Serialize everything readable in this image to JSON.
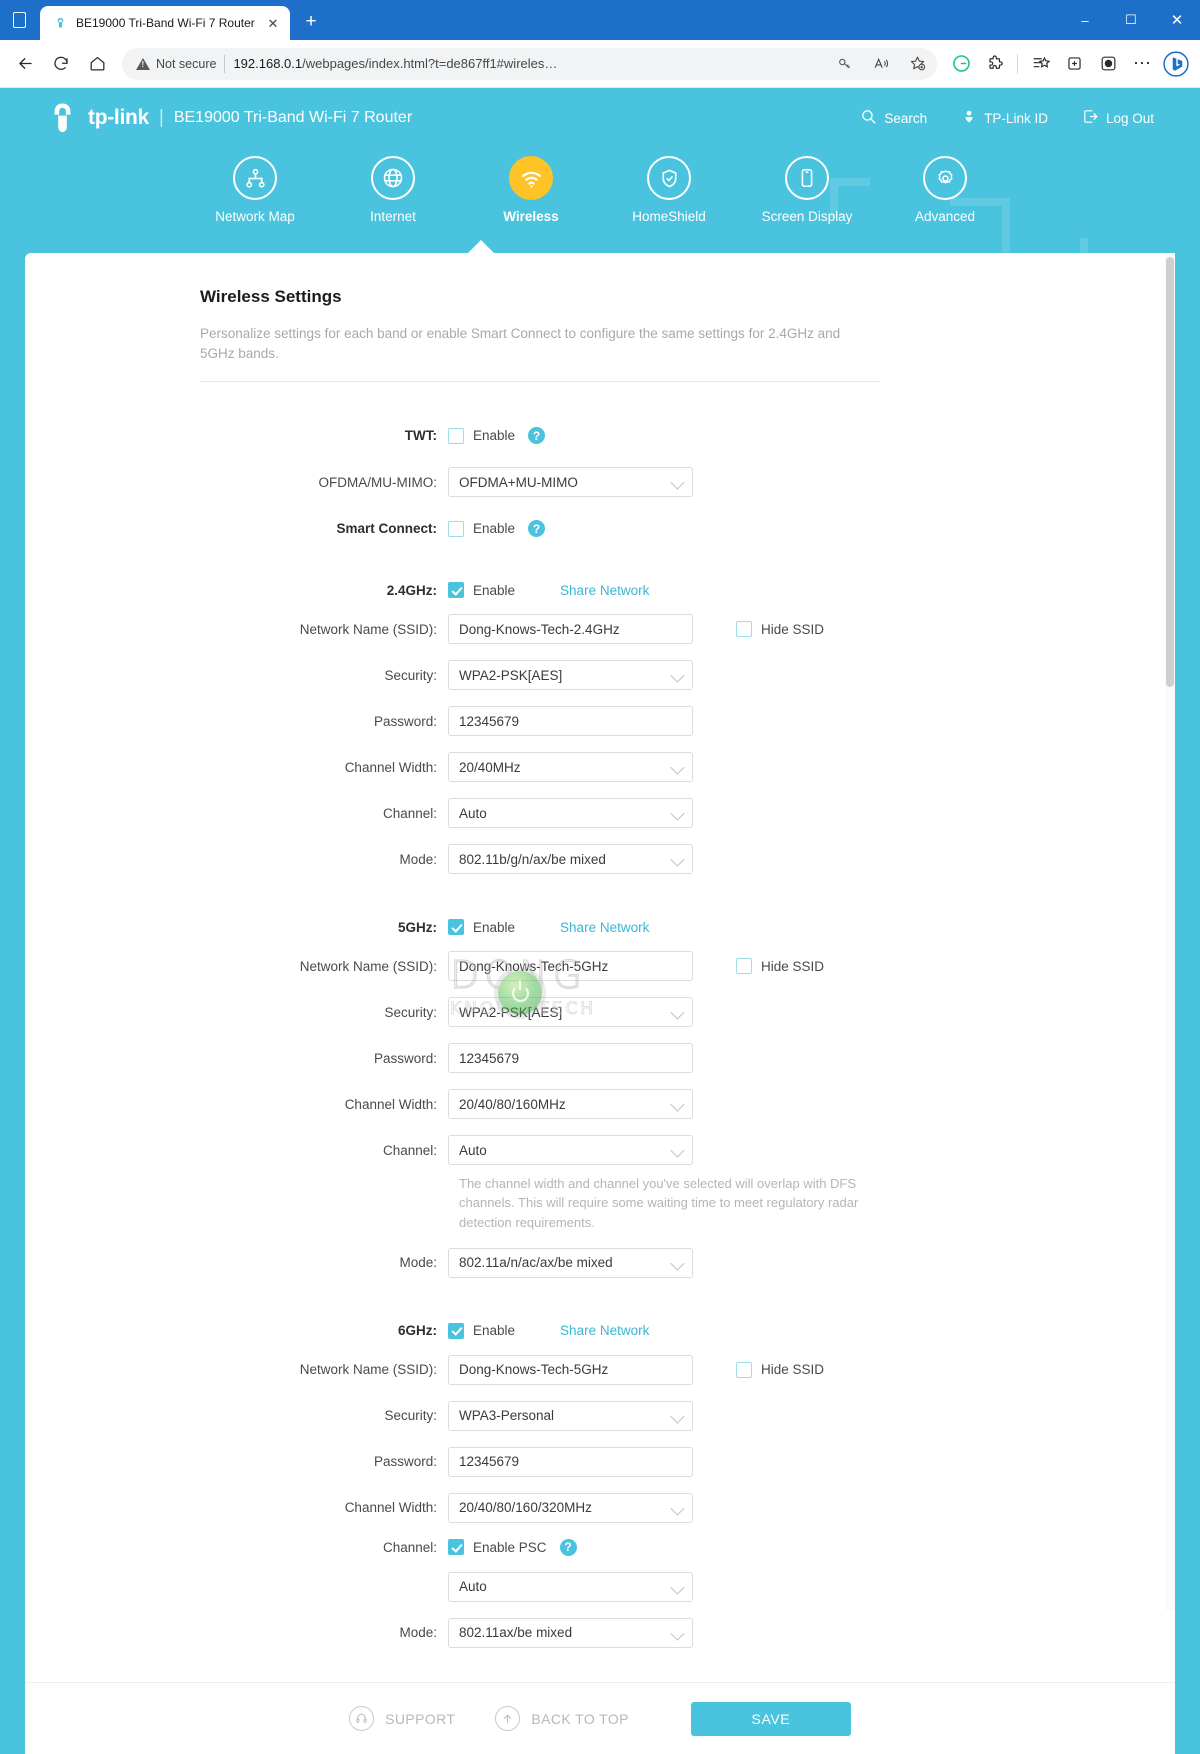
{
  "browser": {
    "tab_title": "BE19000 Tri-Band Wi-Fi 7 Router",
    "tab_favicon_name": "tp-link-favicon",
    "new_tab_label": "+",
    "close_tab_label": "✕",
    "minimize_label": "–",
    "maximize_label": "☐",
    "close_label": "✕",
    "security_label": "Not secure",
    "url_host": "192.168.0.1",
    "url_path": "/webpages/index.html?t=de867ff1#wireles…",
    "back_label": "←",
    "reload_label": "↻",
    "home_label": "⌂",
    "more_label": "⋯"
  },
  "app": {
    "brand": "tp-link",
    "brand_separator": "|",
    "model": "BE19000 Tri-Band Wi-Fi 7 Router",
    "header_actions": [
      {
        "label": "Search",
        "icon": "search-icon"
      },
      {
        "label": "TP-Link ID",
        "icon": "user-icon"
      },
      {
        "label": "Log Out",
        "icon": "logout-icon"
      }
    ],
    "nav": [
      {
        "label": "Network Map",
        "icon": "network-map-icon",
        "active": false
      },
      {
        "label": "Internet",
        "icon": "globe-icon",
        "active": false
      },
      {
        "label": "Wireless",
        "icon": "wifi-icon",
        "active": true
      },
      {
        "label": "HomeShield",
        "icon": "homeshield-icon",
        "active": false
      },
      {
        "label": "Screen Display",
        "icon": "screen-display-icon",
        "active": false
      },
      {
        "label": "Advanced",
        "icon": "gear-icon",
        "active": false
      }
    ],
    "accent_color": "#4ac3de",
    "active_nav_color": "#ffc328"
  },
  "page": {
    "title": "Wireless Settings",
    "description": "Personalize settings for each band or enable Smart Connect to configure the same settings for 2.4GHz and 5GHz bands."
  },
  "global_settings": {
    "twt": {
      "label": "TWT:",
      "checkbox_label": "Enable",
      "checked": false,
      "help": "?"
    },
    "ofdma": {
      "label": "OFDMA/MU-MIMO:",
      "value": "OFDMA+MU-MIMO"
    },
    "smart_connect": {
      "label": "Smart Connect:",
      "checkbox_label": "Enable",
      "checked": false,
      "help": "?"
    }
  },
  "common_labels": {
    "ssid": "Network Name (SSID):",
    "security": "Security:",
    "password": "Password:",
    "channel_width": "Channel Width:",
    "channel": "Channel:",
    "mode": "Mode:",
    "enable": "Enable",
    "hide_ssid": "Hide SSID",
    "share_network": "Share Network"
  },
  "bands": [
    {
      "label": "2.4GHz:",
      "enabled": true,
      "share_network": "Share Network",
      "ssid": "Dong-Knows-Tech-2.4GHz",
      "hide_ssid": false,
      "security": "WPA2-PSK[AES]",
      "password": "12345679",
      "channel_width": "20/40MHz",
      "channel": "Auto",
      "mode": "802.11b/g/n/ax/be mixed",
      "hint": "",
      "psc": null
    },
    {
      "label": "5GHz:",
      "enabled": true,
      "share_network": "Share Network",
      "ssid": "Dong-Knows-Tech-5GHz",
      "hide_ssid": false,
      "security": "WPA2-PSK[AES]",
      "password": "12345679",
      "channel_width": "20/40/80/160MHz",
      "channel": "Auto",
      "mode": "802.11a/n/ac/ax/be mixed",
      "hint": "The channel width and channel you've selected will overlap with DFS channels. This will require some waiting time to meet regulatory radar detection requirements.",
      "psc": null
    },
    {
      "label": "6GHz:",
      "enabled": true,
      "share_network": "Share Network",
      "ssid": "Dong-Knows-Tech-5GHz",
      "hide_ssid": false,
      "security": "WPA3-Personal",
      "password": "12345679",
      "channel_width": "20/40/80/160/320MHz",
      "channel": "Auto",
      "mode": "802.11ax/be mixed",
      "hint": "",
      "psc": {
        "label": "Enable PSC",
        "checked": true,
        "help": "?"
      }
    }
  ],
  "footer": {
    "support": "SUPPORT",
    "back_to_top": "BACK TO TOP",
    "save": "SAVE"
  },
  "watermark": {
    "line1": "DONG",
    "line2": "KNOWS TECH"
  }
}
